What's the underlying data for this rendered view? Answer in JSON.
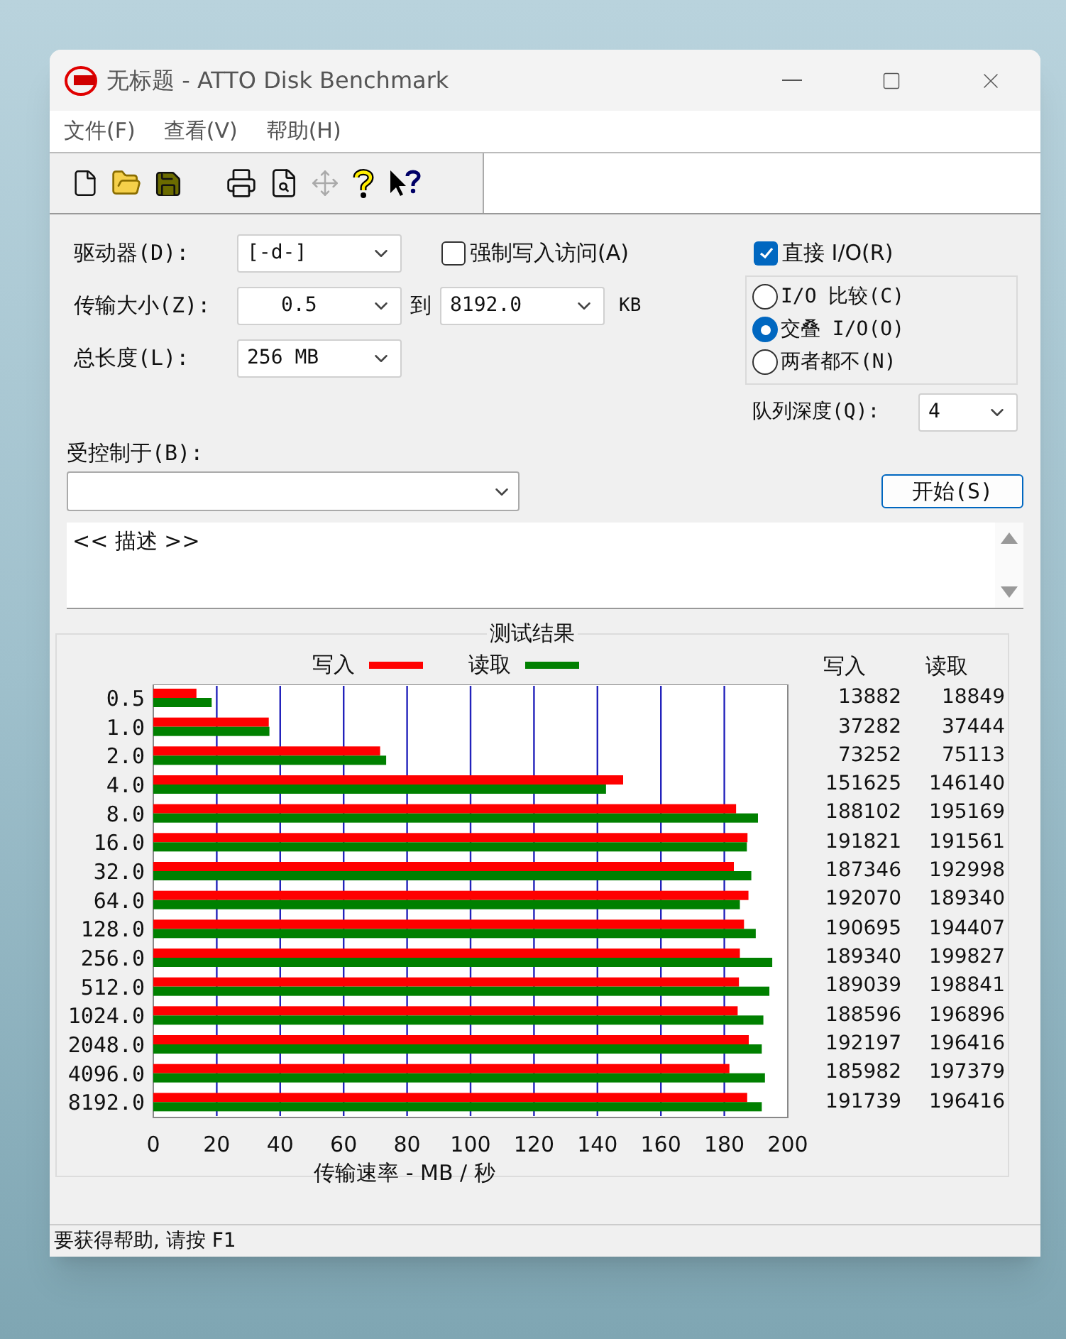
{
  "window": {
    "title": "无标题 - ATTO Disk Benchmark"
  },
  "menu": [
    {
      "label": "文件(F)"
    },
    {
      "label": "查看(V)"
    },
    {
      "label": "帮助(H)"
    }
  ],
  "form": {
    "drive": {
      "label": "驱动器(D):",
      "value": "[-d-]"
    },
    "force_write": {
      "label": "强制写入访问(A)",
      "checked": false
    },
    "transfer_size": {
      "label": "传输大小(Z):",
      "from": "0.5",
      "to_label": "到",
      "to": "8192.0",
      "unit": "KB"
    },
    "total_length": {
      "label": "总长度(L):",
      "value": "256 MB"
    },
    "direct_io": {
      "label": "直接 I/O(R)",
      "checked": true
    },
    "io_mode": [
      {
        "label": "I/O 比较(C)",
        "selected": false
      },
      {
        "label": "交叠 I/O(O)",
        "selected": true
      },
      {
        "label": "两者都不(N)",
        "selected": false
      }
    ],
    "queue_depth": {
      "label": "队列深度(Q):",
      "value": "4"
    },
    "controlled_by": {
      "label": "受控制于(B):"
    },
    "start_button": "开始(S)",
    "description": "<< 描述 >>"
  },
  "results": {
    "table_headers": [
      "写入",
      "读取"
    ],
    "rows": [
      {
        "write": "13882",
        "read": "18849"
      },
      {
        "write": "37282",
        "read": "37444"
      },
      {
        "write": "73252",
        "read": "75113"
      },
      {
        "write": "151625",
        "read": "146140"
      },
      {
        "write": "188102",
        "read": "195169"
      },
      {
        "write": "191821",
        "read": "191561"
      },
      {
        "write": "187346",
        "read": "192998"
      },
      {
        "write": "192070",
        "read": "189340"
      },
      {
        "write": "190695",
        "read": "194407"
      },
      {
        "write": "189340",
        "read": "199827"
      },
      {
        "write": "189039",
        "read": "198841"
      },
      {
        "write": "188596",
        "read": "196896"
      },
      {
        "write": "192197",
        "read": "196416"
      },
      {
        "write": "185982",
        "read": "197379"
      },
      {
        "write": "191739",
        "read": "196416"
      }
    ],
    "chart_data": {
      "type": "bar",
      "orientation": "horizontal",
      "title": "测试结果",
      "xlabel": "传输速率 - MB / 秒",
      "categories": [
        "0.5",
        "1.0",
        "2.0",
        "4.0",
        "8.0",
        "16.0",
        "32.0",
        "64.0",
        "128.0",
        "256.0",
        "512.0",
        "1024.0",
        "2048.0",
        "4096.0",
        "8192.0"
      ],
      "series": [
        {
          "name": "写入",
          "color": "#ff0000",
          "values": [
            13.6,
            36.4,
            71.5,
            148.1,
            183.7,
            187.3,
            183.0,
            187.6,
            186.2,
            184.9,
            184.6,
            184.2,
            187.7,
            181.6,
            187.2
          ]
        },
        {
          "name": "读取",
          "color": "#008000",
          "values": [
            18.4,
            36.6,
            73.4,
            142.7,
            190.6,
            187.1,
            188.5,
            184.9,
            189.9,
            195.1,
            194.2,
            192.3,
            191.8,
            192.8,
            191.8
          ]
        }
      ],
      "grid": true,
      "xlim": [
        0,
        200
      ],
      "xticks": [
        0,
        20,
        40,
        60,
        80,
        100,
        120,
        140,
        160,
        180,
        200
      ]
    }
  },
  "status_bar": "要获得帮助, 请按 F1"
}
